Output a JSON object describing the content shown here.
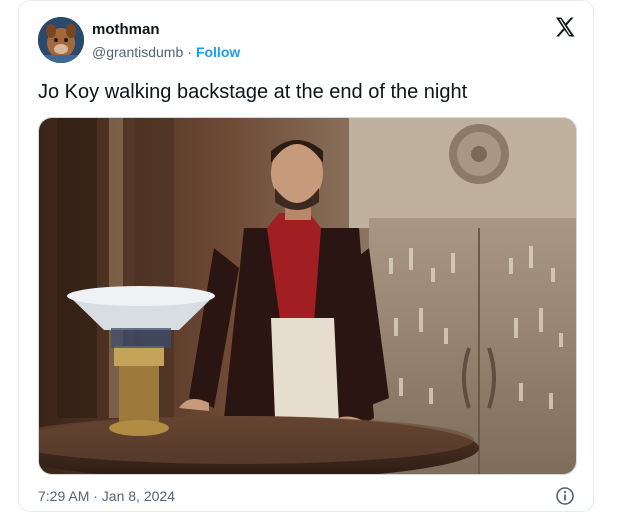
{
  "tweet": {
    "display_name": "mothman",
    "handle": "@grantisdumb",
    "separator": "·",
    "follow_label": "Follow",
    "text": "Jo Koy walking backstage at the end of the night",
    "timestamp": "7:29 AM · Jan 8, 2024"
  },
  "icons": {
    "platform_logo": "x-logo-icon",
    "info": "info-icon"
  },
  "colors": {
    "follow": "#1d9bf0",
    "secondary_text": "#536471",
    "primary_text": "#0f1419"
  }
}
